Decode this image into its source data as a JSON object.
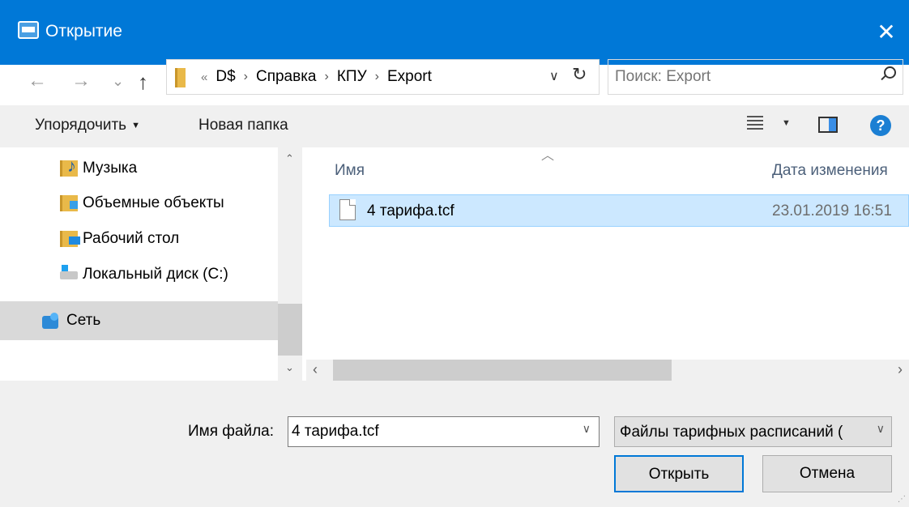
{
  "window": {
    "title": "Открытие",
    "close_glyph": "✕"
  },
  "nav": {
    "back": "←",
    "forward": "→",
    "recent": "⌄",
    "up": "↑"
  },
  "address": {
    "overflow": "«",
    "crumbs": [
      "D$",
      "Справка",
      "КПУ",
      "Export"
    ],
    "separator": "›",
    "dropdown": "∨",
    "refresh": "↻"
  },
  "search": {
    "placeholder": "Поиск: Export"
  },
  "toolbar": {
    "organize": "Упорядочить",
    "new_folder": "Новая папка"
  },
  "sidebar": {
    "items": [
      {
        "label": "Музыка",
        "icon": "music-folder-icon"
      },
      {
        "label": "Объемные объекты",
        "icon": "3d-objects-icon"
      },
      {
        "label": "Рабочий стол",
        "icon": "desktop-folder-icon"
      },
      {
        "label": "Локальный диск (C:)",
        "icon": "local-disk-icon"
      },
      {
        "label": "Сеть",
        "icon": "network-icon",
        "selected": true
      }
    ]
  },
  "filelist": {
    "columns": {
      "name": "Имя",
      "date": "Дата изменения"
    },
    "sort_glyph": "︿",
    "rows": [
      {
        "name": "4 тарифа.tcf",
        "date": "23.01.2019 16:51",
        "selected": true
      }
    ]
  },
  "bottom": {
    "filename_label": "Имя файла:",
    "filename_value": "4 тарифа.tcf",
    "filter_value": "Файлы тарифных расписаний (",
    "open_button": "Открыть",
    "cancel_button": "Отмена"
  },
  "colors": {
    "titlebar": "#0078d7",
    "selection": "#cce8ff",
    "help": "#1b7fd3"
  }
}
